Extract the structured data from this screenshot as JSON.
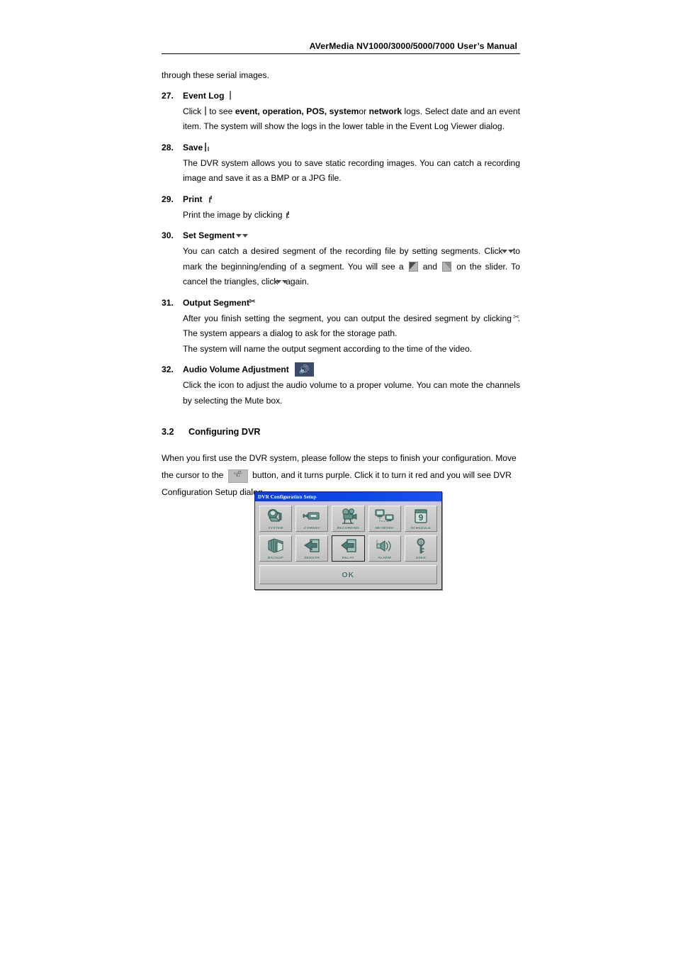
{
  "header": {
    "title": "AVerMedia NV1000/3000/5000/7000 User’s Manual"
  },
  "intro_line": "through these serial images.",
  "items": [
    {
      "num": "27.",
      "title": "Event Log",
      "icon": "event-log-icon",
      "paragraph_parts": {
        "p1": "Click",
        "p2": "to see",
        "b1": "event, operation, POS, system",
        "p3": "or",
        "b2": "network",
        "p4": "logs. Select date and an event item. The system will show the logs in the lower table in the Event Log Viewer dialog."
      }
    },
    {
      "num": "28.",
      "title": "Save",
      "icon": "save-icon",
      "paragraph": "The DVR system allows you to save static recording images.   You can catch a recording image and save it as a BMP or a JPG file."
    },
    {
      "num": "29.",
      "title": "Print",
      "icon": "print-icon",
      "paragraph_parts": {
        "p1": "Print the image by clicking",
        "p2": "."
      }
    },
    {
      "num": "30.",
      "title": "Set Segment",
      "icon": "set-segment-icon",
      "paragraph_parts": {
        "p1": "You can catch a desired segment of the recording file by setting segments. Click",
        "p2": "to mark the beginning/ending of a segment. You will see a",
        "p3": "and",
        "p4": "on the slider. To cancel the triangles, click",
        "p5": "again."
      }
    },
    {
      "num": "31.",
      "title": "Output Segment",
      "icon": "output-segment-icon",
      "paragraph_parts": {
        "p1": "After you finish setting the segment, you can output the desired segment by clicking",
        "p2": ". The system appears a dialog to ask for the storage path."
      },
      "paragraph2": "The system will name the output segment according to the time of the video."
    },
    {
      "num": "32.",
      "title": "Audio Volume Adjustment",
      "icon": "audio-volume-icon",
      "paragraph": "Click the icon to adjust the audio volume to a proper volume. You can mote the channels by selecting the Mute box."
    }
  ],
  "section": {
    "number": "3.2",
    "title": "Configuring DVR",
    "para_parts": {
      "p1": "When you first use the DVR system, please follow the steps to finish your configuration. Move the cursor to the",
      "p2": "button, and it turns purple. Click it to turn it red and you will see DVR Configuration Setup dialog."
    },
    "setup_button": {
      "glyph": "ℰ",
      "label": "SETUP"
    }
  },
  "dialog": {
    "title": "DVR Configuration Setup",
    "row1": [
      {
        "label": "SYSTEM",
        "icon": "computer-icon"
      },
      {
        "label": "CAMERA",
        "icon": "camera-icon"
      },
      {
        "label": "RECORDING",
        "icon": "movie-camera-icon"
      },
      {
        "label": "NETWORK",
        "icon": "network-icon"
      },
      {
        "label": "SCHEDULE",
        "icon": "calendar-icon",
        "badge": "9"
      }
    ],
    "row2": [
      {
        "label": "BACKUP",
        "icon": "backup-disks-icon",
        "selected": false
      },
      {
        "label": "SENSOR",
        "icon": "arrow-in-icon",
        "selected": false
      },
      {
        "label": "RELAY",
        "icon": "arrow-out-icon",
        "selected": true
      },
      {
        "label": "ALARM",
        "icon": "siren-icon",
        "selected": false
      },
      {
        "label": "USER",
        "icon": "key-icon",
        "selected": false
      }
    ],
    "ok_label": "OK",
    "colors": {
      "titlebar": "#0d46e8",
      "face": "#c9c9c9",
      "label_text": "#3e6b68",
      "icon_green": "#4a7d78"
    }
  }
}
